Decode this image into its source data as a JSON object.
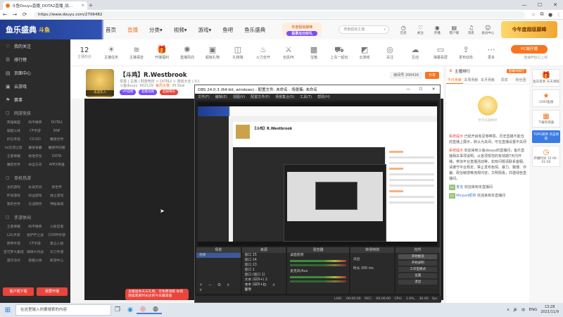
{
  "browser": {
    "tab_title": "斗鱼Douyu直播_DOTA2直播_战…",
    "tab_close": "×",
    "new_tab": "+",
    "url": "https://www.douyu.com/2706482",
    "window_controls": [
      "—",
      "☐",
      "✕"
    ]
  },
  "site_header": {
    "logo_text": "鱼乐盛典",
    "logo_sub": "斗鱼",
    "nav": [
      {
        "label": "首页",
        "active": false
      },
      {
        "label": "直播",
        "active": true
      },
      {
        "label": "分类▾",
        "active": false
      },
      {
        "label": "视频▾",
        "active": false
      },
      {
        "label": "游戏▾",
        "active": false
      },
      {
        "label": "鱼吧",
        "active": false
      },
      {
        "label": "鱼乐盛典",
        "active": false
      }
    ],
    "banner_text": "年度超级巅峰",
    "banner_btn": "投票瓜分好礼",
    "search_placeholder": "搜索超级主播",
    "icons": [
      {
        "icon": "clock",
        "label": "历史"
      },
      {
        "icon": "heart",
        "label": "关注"
      },
      {
        "icon": "broadcast",
        "label": "开播"
      },
      {
        "icon": "store",
        "label": "客户端"
      },
      {
        "icon": "bell",
        "label": "消息"
      },
      {
        "icon": "user",
        "label": "会员中心"
      }
    ],
    "promo_text": "今年度超级巅峰"
  },
  "sidebar": {
    "top_items": [
      {
        "icon": "heart",
        "label": "我的关注"
      },
      {
        "icon": "list",
        "label": "排行榜"
      },
      {
        "icon": "page",
        "label": "页面中心"
      },
      {
        "icon": "gift",
        "label": "云游戏"
      },
      {
        "icon": "flag",
        "label": "赛事"
      }
    ],
    "sections": [
      {
        "title": "网游竞技",
        "items": [
          "英雄联盟",
          "和平精英",
          "DOTA2",
          "穿越火线",
          "CF手游",
          "DNF",
          "炉石传说",
          "CS:GO",
          "魔兽世界",
          "lol云顶之弈",
          "魔兽争霸",
          "魔兽怀旧服",
          "王者荣耀",
          "绝地求生",
          "DOTA",
          "魔兽世界",
          "命运方舟",
          "APEX英雄"
        ]
      },
      {
        "title": "单机热游",
        "items": [
          "主机游戏",
          "永劫无间",
          "新世界",
          "怀旧游戏",
          "喷血游戏",
          "独立游戏",
          "我的世界",
          "天涯明月",
          "神秘海域"
        ]
      },
      {
        "title": "手游休闲",
        "items": [
          "王者荣耀",
          "和平精英",
          "火影忍者",
          "LOL手游",
          "金铲铲之战",
          "CODM手游",
          "原神手游",
          "CF手游",
          "第五人格",
          "宝可梦大集结",
          "球球大作战",
          "天刀手游",
          "蛋仔派对",
          "穿越火线",
          "新游中心"
        ]
      }
    ],
    "bottom_buttons": [
      "客户端下载",
      "我要开播"
    ]
  },
  "toolbar": {
    "follow_count": "12",
    "follow_label": "主播粉丝",
    "tools": [
      {
        "icon": "sun",
        "label": "主播任务"
      },
      {
        "icon": "wave",
        "label": "主播语音"
      },
      {
        "icon": "gift",
        "label": "开播福利"
      },
      {
        "icon": "fan",
        "label": "直播风向"
      },
      {
        "icon": "box",
        "label": "超级礼物"
      },
      {
        "icon": "bag",
        "label": "礼物墙"
      },
      {
        "icon": "fire",
        "label": "火力全开"
      },
      {
        "icon": "pk",
        "label": "全民PK"
      },
      {
        "icon": "chest",
        "label": "宝箱"
      },
      {
        "icon": "car",
        "label": "上车一起玩"
      },
      {
        "icon": "game",
        "label": "云游戏"
      },
      {
        "icon": "eye",
        "label": "关注"
      },
      {
        "icon": "cloud",
        "label": "互动"
      },
      {
        "icon": "screen",
        "label": "弹幕投屏"
      },
      {
        "icon": "share",
        "label": "发布动态"
      },
      {
        "icon": "more",
        "label": "更多"
      }
    ],
    "pc_button": "PC端开播",
    "pc_sub": "直播伴侣已上线"
  },
  "room": {
    "title": "【斗鸡】R.Westbrook",
    "meta": "举报 | 主播 | 网游竞技 > DOTA2 > 游戏大全 | 0人",
    "host_line": "斗鱼douyu",
    "fans": "602129",
    "hot": "每周大赛",
    "watch": "35.5kw",
    "badge": "未成年人",
    "tags": [
      "VR视频",
      "超能视频",
      "超级精彩"
    ],
    "room_id": "房间号 200416",
    "share": "分享"
  },
  "player": {
    "gift_banner": "主播送你天天礼物，可免费领取 你的连续观看时长达到今日最高值"
  },
  "obs": {
    "title": "OBS 24.0.3 (64-bit, windows) - 配置文件: 未命名 - 场景集: 未命名",
    "menu": [
      "文件(F)",
      "编辑(E)",
      "视图(V)",
      "配置文件(P)",
      "场景集合(S)",
      "工具(T)",
      "帮助(H)"
    ],
    "nested_title": "【斗鸡】R.Westbrook",
    "docks": {
      "scenes": {
        "title": "场景",
        "items": [
          "场景"
        ]
      },
      "sources": {
        "title": "来源",
        "items": [
          "窗口 15",
          "窗口 14",
          "窗口 13",
          "窗口 1",
          "窗口 (窗口 1)",
          "文本 (GDI+) 2",
          "文本 (GDI+)",
          "图像"
        ]
      },
      "mixer": {
        "title": "混音器",
        "items": [
          "桌面音频",
          "麦克风/Aux"
        ]
      },
      "transitions": {
        "title": "转场特效",
        "items": [
          "淡出",
          "时长 300 ms"
        ]
      },
      "controls": {
        "title": "控件",
        "items": [
          "开始推流",
          "开始录制",
          "工作室模式",
          "设置",
          "退出"
        ]
      }
    },
    "dock_footer": "+ − ⚙ ∧ ∨",
    "status": "LIVE: 00:00:00  REC: 00:00:00  CPU: 1.6%, 30.00 fps"
  },
  "chat": {
    "top_label": "主播排行",
    "rank_btn": "直播间排行",
    "tabs": [
      {
        "label": "今日贡献",
        "active": true
      },
      {
        "label": "本周贡献",
        "active": false
      },
      {
        "label": "本月贡献",
        "active": false
      },
      {
        "label": "贵宾",
        "active": false
      },
      {
        "label": "粉丝团",
        "active": false
      }
    ],
    "illus_caption": "暂无贡献榜单",
    "messages": [
      {
        "tag": "系统提示",
        "text": "已经开启有足够带票。历史直播不能当前直播上展示，默认为关闭，可在直播设置中关闭"
      },
      {
        "tag": "系统提示",
        "text": "欢迎来到斗鱼douyu的直播间，鱼乐直播相关事项说明，从各项规范的有效期7天内开播，参加平台直播活动等，如有问题请联系客服。请遵守平台规定，禁止发布色情、暴力、赌博、诈骗、政治敏感等违规内容，文明观看，共建绿色直播间。"
      },
      {
        "tag": "",
        "user": "麦克",
        "text": "欢迎来到本直播间"
      },
      {
        "tag": "",
        "user": "Minpad昵称",
        "text": "欢迎来到本直播间"
      }
    ]
  },
  "right_strip": {
    "items": [
      {
        "icon": "gift",
        "label": "鱼乐签到 天天领取"
      },
      {
        "icon": "star",
        "label": "1200鱼翅"
      },
      {
        "icon": "calendar",
        "label": "下载有惊喜"
      },
      {
        "icon": "blue",
        "label": "TOP1榜单 点击领取"
      },
      {
        "icon": "clock",
        "label": "开播时间 15:00 - 01:00"
      }
    ]
  },
  "taskbar": {
    "search_placeholder": "在这里输入你要搜索的内容",
    "apps": [
      "task-view",
      "edge",
      "chrome",
      "obs"
    ],
    "tray": [
      "∧",
      "🔊",
      "中",
      "ENG"
    ],
    "time": "13:28",
    "date": "2021/11/9"
  }
}
